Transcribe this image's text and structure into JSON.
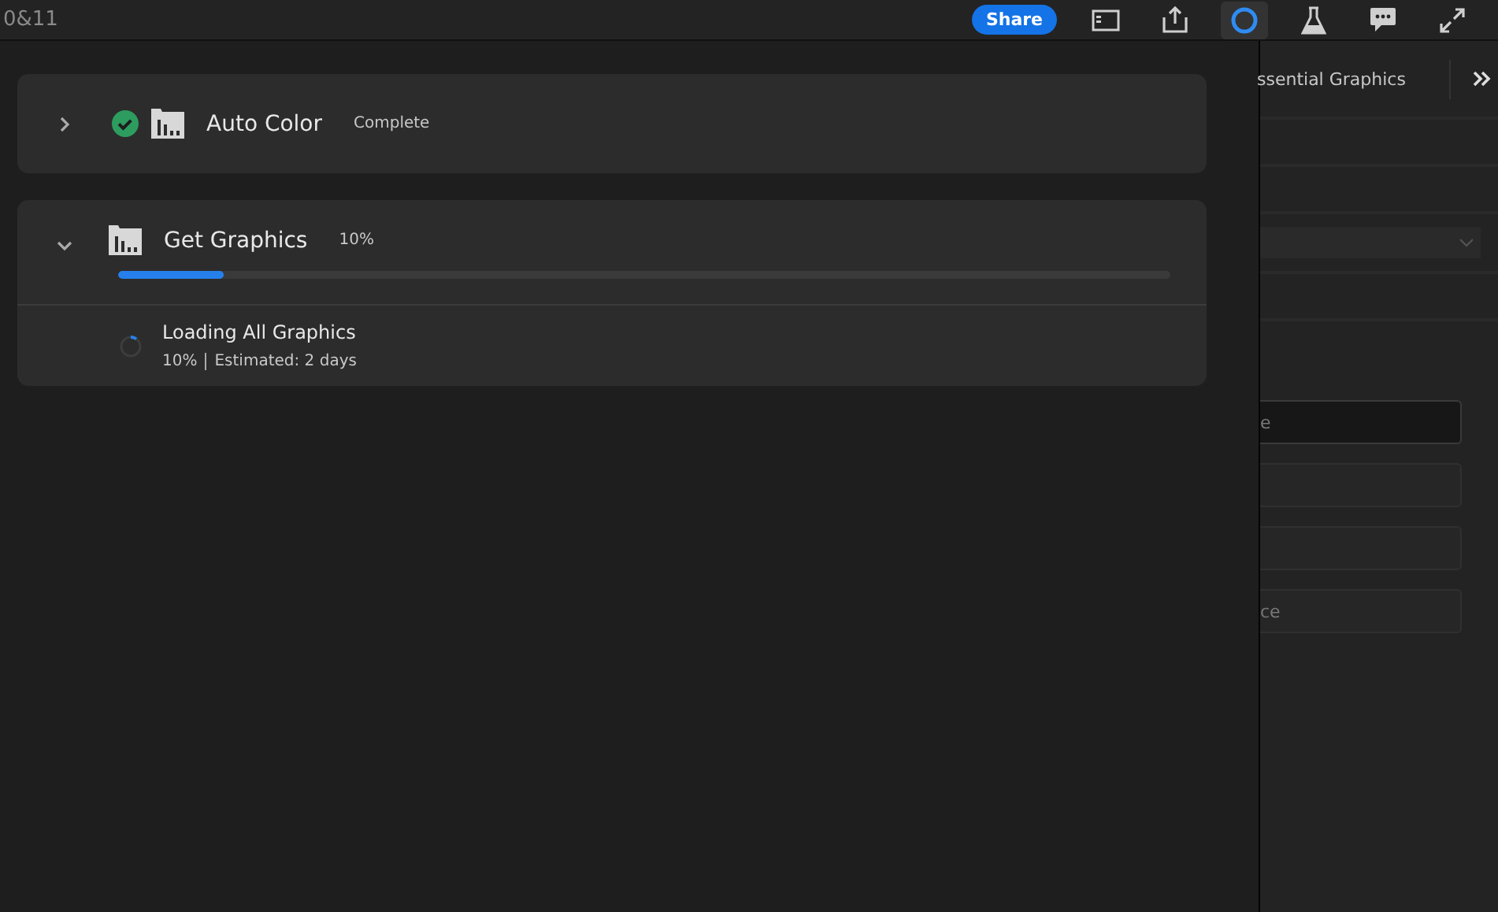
{
  "top_bar": {
    "title": "0&11",
    "share_button": "Share",
    "tools": [
      {
        "kind": "panel",
        "selected": false
      },
      {
        "kind": "export",
        "selected": false
      },
      {
        "kind": "progress",
        "selected": true
      },
      {
        "kind": "flask",
        "selected": false
      },
      {
        "kind": "comments",
        "selected": false
      },
      {
        "kind": "fullscreen",
        "selected": false
      }
    ]
  },
  "tasks": [
    {
      "title": "Auto Color",
      "status": "Complete",
      "expanded": false,
      "complete": true
    },
    {
      "title": "Get Graphics",
      "status": "10%",
      "expanded": true,
      "complete": false,
      "level": 0.1,
      "subtasks": [
        {
          "title": "Loading All Graphics",
          "percent": "10%",
          "estimate": "Estimated: 2 days",
          "level": 0.1
        }
      ]
    }
  ],
  "side_panel": {
    "tab": "ssential Graphics",
    "fields": [
      {
        "value": "e",
        "focused": true
      },
      {
        "focused": false
      },
      {
        "focused": false
      },
      {
        "value": "ce",
        "focused": false
      }
    ]
  }
}
